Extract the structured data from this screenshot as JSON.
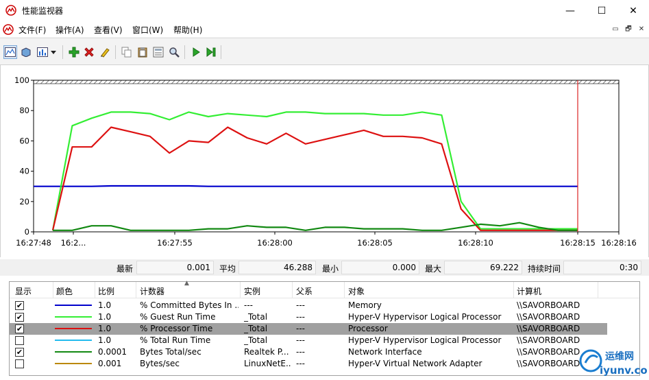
{
  "window": {
    "title": "性能监视器",
    "minimize": "—",
    "maximize": "☐",
    "close": "✕"
  },
  "menu": {
    "items": [
      "文件(F)",
      "操作(A)",
      "查看(V)",
      "窗口(W)",
      "帮助(H)"
    ],
    "mdi": [
      "▭",
      "🗗",
      "✕"
    ]
  },
  "toolbar": {
    "buttons": [
      "view-graph-icon",
      "view-histogram-icon",
      "change-graph-type-icon",
      "dropdown-arrow-icon",
      "add-counter-icon",
      "delete-counter-icon",
      "highlight-icon",
      "copy-properties-icon",
      "paste-counter-list-icon",
      "properties-icon",
      "zoom-icon",
      "unfreeze-display-icon",
      "update-data-icon"
    ]
  },
  "chart_data": {
    "type": "line",
    "ylim": [
      0,
      100
    ],
    "yticks": [
      "100",
      "80",
      "60",
      "40",
      "20",
      "0"
    ],
    "xtick_labels": [
      "16:27:48",
      "16:2...",
      "16:27:55",
      "16:28:00",
      "16:28:05",
      "16:28:10",
      "16:28:15",
      "16:28:16"
    ],
    "series": [
      {
        "name": "% Committed Bytes In ...",
        "color": "#0000cc",
        "values": [
          30,
          30,
          30,
          30.3,
          30.3,
          30.3,
          30.3,
          30.3,
          30,
          30,
          30,
          30,
          30,
          30,
          30,
          30,
          30,
          30,
          30,
          30,
          30,
          30,
          30,
          30,
          30,
          30,
          30,
          30
        ]
      },
      {
        "name": "% Guest Run Time",
        "color": "#33ee33",
        "values": [
          1,
          70,
          75,
          79,
          79,
          78,
          74,
          79,
          76,
          78,
          77,
          76,
          79,
          79,
          78,
          78,
          78,
          77,
          77,
          79,
          77,
          20,
          2,
          2,
          2,
          2,
          2,
          2
        ]
      },
      {
        "name": "% Processor Time",
        "color": "#dd1111",
        "values": [
          1,
          56,
          56,
          69,
          66,
          63,
          52,
          60,
          59,
          69,
          62,
          58,
          65,
          58,
          61,
          64,
          67,
          63,
          63,
          62,
          58,
          15,
          1,
          1,
          1,
          1,
          1,
          1
        ]
      },
      {
        "name": "Bytes Total/sec",
        "color": "#118811",
        "values": [
          1,
          1,
          4,
          4,
          1,
          1,
          1,
          1,
          2,
          2,
          4,
          3,
          3,
          1,
          3,
          3,
          2,
          2,
          2,
          1,
          1,
          3,
          5,
          4,
          6,
          3,
          1,
          1
        ]
      }
    ]
  },
  "stats": {
    "min_label": "最新",
    "min_value": "0.001",
    "avg_label": "平均",
    "avg_value": "46.288",
    "low_label": "最小",
    "low_value": "0.000",
    "max_label": "最大",
    "max_value": "69.222",
    "dur_label": "持续时间",
    "dur_value": "0:30"
  },
  "table": {
    "headers": [
      "显示",
      "颜色",
      "比例",
      "计数器",
      "实例",
      "父系",
      "对象",
      "计算机"
    ],
    "rows": [
      {
        "checked": true,
        "color": "#0000cc",
        "scale": "1.0",
        "counter": "% Committed Bytes In ...",
        "instance": "---",
        "parent": "---",
        "object": "Memory",
        "computer": "\\\\SAVORBOARD",
        "selected": false
      },
      {
        "checked": true,
        "color": "#33ee33",
        "scale": "1.0",
        "counter": "% Guest Run Time",
        "instance": "_Total",
        "parent": "---",
        "object": "Hyper-V Hypervisor Logical Processor",
        "computer": "\\\\SAVORBOARD",
        "selected": false
      },
      {
        "checked": true,
        "color": "#dd1111",
        "scale": "1.0",
        "counter": "% Processor Time",
        "instance": "_Total",
        "parent": "---",
        "object": "Processor",
        "computer": "\\\\SAVORBOARD",
        "selected": true
      },
      {
        "checked": false,
        "color": "#22bbee",
        "scale": "1.0",
        "counter": "% Total Run Time",
        "instance": "_Total",
        "parent": "---",
        "object": "Hyper-V Hypervisor Logical Processor",
        "computer": "\\\\SAVORBOARD",
        "selected": false
      },
      {
        "checked": true,
        "color": "#118811",
        "scale": "0.0001",
        "counter": "Bytes Total/sec",
        "instance": "Realtek P...",
        "parent": "---",
        "object": "Network Interface",
        "computer": "\\\\SAVORBOARD",
        "selected": false
      },
      {
        "checked": false,
        "color": "#bb8800",
        "scale": "0.001",
        "counter": "Bytes/sec",
        "instance": "LinuxNetE...",
        "parent": "---",
        "object": "Hyper-V Virtual Network Adapter",
        "computer": "\\\\SAVORBOARD",
        "selected": false
      }
    ]
  },
  "watermark": {
    "text_cn": "运维网",
    "text_url": "iyunv.com"
  }
}
